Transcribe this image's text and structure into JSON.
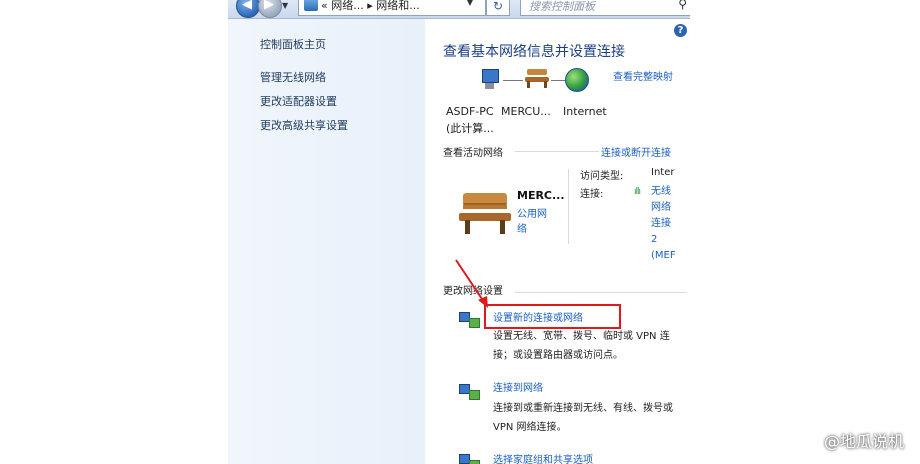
{
  "addressbar": {
    "crumb_text": "« 网络... ▸ 网络和...",
    "search_placeholder": "搜索控制面板"
  },
  "sidebar": {
    "items": [
      {
        "label": "控制面板主页"
      },
      {
        "label": "管理无线网络"
      },
      {
        "label": "更改适配器设置"
      },
      {
        "label": "更改高级共享设置"
      }
    ]
  },
  "main": {
    "title": "查看基本网络信息并设置连接",
    "full_map_link": "查看完整映射",
    "nodes": {
      "pc_line1": "ASDF-PC",
      "pc_line2": "(此计算...",
      "router": "MERCU...",
      "internet": "Internet"
    },
    "active_section": "查看活动网络",
    "connect_link": "连接或断开连接",
    "network": {
      "name": "MERC...",
      "type_lines": [
        "公用网",
        "络"
      ],
      "access_key": "访问类型:",
      "access_value": "Inter",
      "conn_key": "连接:",
      "signal": "ıllı",
      "conn_lines": [
        "无线",
        "网络",
        "连接",
        "2",
        "(MEF"
      ]
    },
    "change_section": "更改网络设置",
    "tasks": [
      {
        "title": "设置新的连接或网络",
        "desc": "设置无线、宽带、拨号、临时或 VPN 连接；或设置路由器或访问点。"
      },
      {
        "title": "连接到网络",
        "desc": "连接到或重新连接到无线、有线、拨号或 VPN 网络连接。"
      },
      {
        "title": "选择家庭组和共享选项",
        "desc": ""
      }
    ]
  },
  "watermark": "@地瓜说机",
  "colors": {
    "link": "#1b5fc2",
    "title": "#1b3f86",
    "highlight": "#e01a1a"
  }
}
